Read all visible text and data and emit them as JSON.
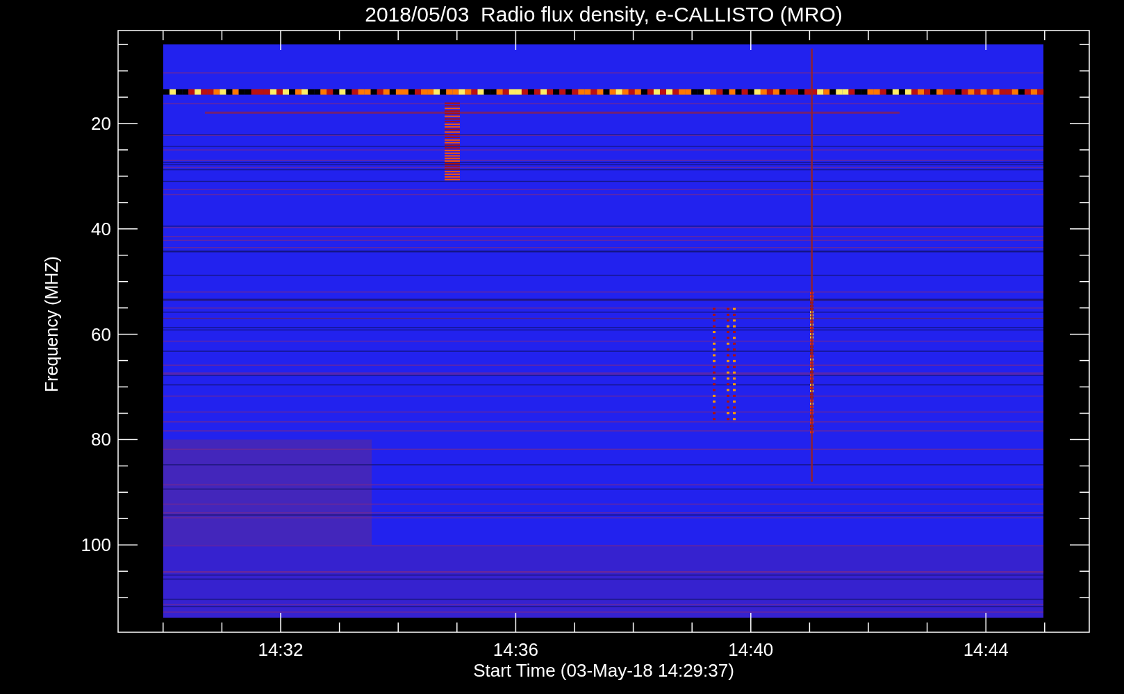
{
  "title": "2018/05/03  Radio flux density, e-CALLISTO (MRO)",
  "y_axis": {
    "label": "Frequency (MHZ)",
    "ticks": [
      "20",
      "40",
      "60",
      "80",
      "100"
    ]
  },
  "x_axis": {
    "label": "Start Time (03-May-18 14:29:37)",
    "ticks": [
      "14:32",
      "14:36",
      "14:40",
      "14:44"
    ]
  }
}
